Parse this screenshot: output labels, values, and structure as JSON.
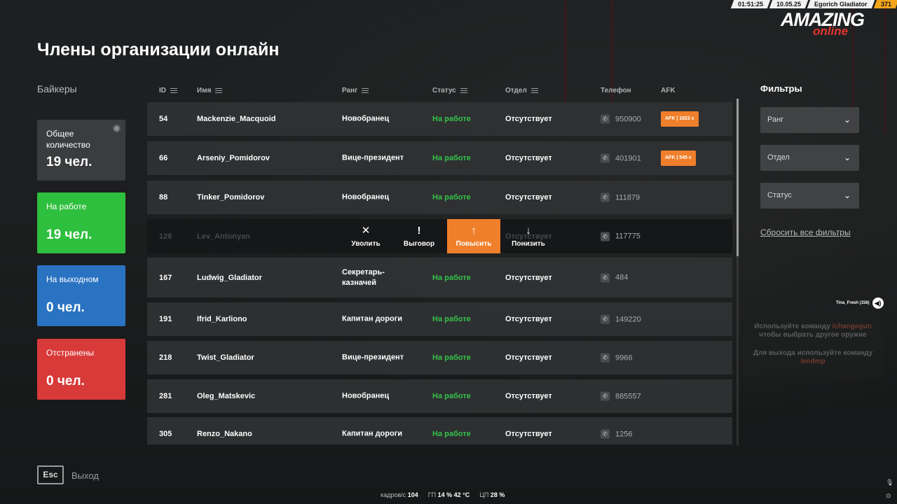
{
  "hud": {
    "time": "01:51:25",
    "date": "10.05.25",
    "player": "Egorich Gladiator",
    "level": "371"
  },
  "logo": {
    "top": "AMAZING",
    "bottom": "online"
  },
  "page_title": "Члены организации онлайн",
  "org_name": "Байкеры",
  "stats": {
    "total": {
      "label": "Общее количество",
      "value": "19 чел."
    },
    "working": {
      "label": "На работе",
      "value": "19 чел."
    },
    "off": {
      "label": "На выходном",
      "value": "0 чел."
    },
    "suspended": {
      "label": "Отстранены",
      "value": "0 чел."
    }
  },
  "table": {
    "headers": {
      "id": "ID",
      "name": "Имя",
      "rank": "Ранг",
      "status": "Статус",
      "dept": "Отдел",
      "phone": "Телефон",
      "afk": "AFK"
    },
    "rows": [
      {
        "id": "54",
        "name": "Mackenzie_Macquoid",
        "rank": "Новобранец",
        "status": "На работе",
        "dept": "Отсутствует",
        "phone": "950900",
        "afk": "AFK  |  1823 с"
      },
      {
        "id": "66",
        "name": "Arseniy_Pomidorov",
        "rank": "Вице-президент",
        "status": "На работе",
        "dept": "Отсутствует",
        "phone": "401901",
        "afk": "AFK  |  545 с"
      },
      {
        "id": "88",
        "name": "Tinker_Pomidorov",
        "rank": "Новобранец",
        "status": "На работе",
        "dept": "Отсутствует",
        "phone": "111879",
        "afk": ""
      },
      {
        "id": "126",
        "name": "Lev_Antonyan",
        "rank": "",
        "status": "",
        "dept": "Отсутствует",
        "phone": "117775",
        "afk": ""
      },
      {
        "id": "167",
        "name": "Ludwig_Gladiator",
        "rank": "Секретарь-казначей",
        "status": "На работе",
        "dept": "Отсутствует",
        "phone": "484",
        "afk": ""
      },
      {
        "id": "191",
        "name": "Ifrid_Karliono",
        "rank": "Капитан дороги",
        "status": "На работе",
        "dept": "Отсутствует",
        "phone": "149220",
        "afk": ""
      },
      {
        "id": "218",
        "name": "Twist_Gladiator",
        "rank": "Вице-президент",
        "status": "На работе",
        "dept": "Отсутствует",
        "phone": "9966",
        "afk": ""
      },
      {
        "id": "281",
        "name": "Oleg_Matskevic",
        "rank": "Новобранец",
        "status": "На работе",
        "dept": "Отсутствует",
        "phone": "885557",
        "afk": ""
      },
      {
        "id": "305",
        "name": "Renzo_Nakano",
        "rank": "Капитан дороги",
        "status": "На работе",
        "dept": "Отсутствует",
        "phone": "1256",
        "afk": ""
      }
    ]
  },
  "row_actions": {
    "fire": {
      "icon": "close-icon",
      "label": "Уволить"
    },
    "reprimand": {
      "icon": "exclamation-icon",
      "label": "Выговор"
    },
    "promote": {
      "icon": "arrow-up-icon",
      "label": "Повысить"
    },
    "demote": {
      "icon": "arrow-down-icon",
      "label": "Понизить"
    }
  },
  "filters": {
    "title": "Фильтры",
    "rank": "Ранг",
    "dept": "Отдел",
    "status": "Статус",
    "reset": "Сбросить все фильтры"
  },
  "voice": {
    "speaker": "Tina_Fresh (158)"
  },
  "hint": {
    "line1": "Используйте команду",
    "cmd1": "/changegun",
    "line2": "чтобы выбрать другое оружие",
    "line3": "Для выхода используйте команду",
    "cmd2": "/endmp"
  },
  "footer": {
    "esc": "Esc",
    "exit": "Выход"
  },
  "perf": {
    "fps_label": "кадров/с",
    "fps": "104",
    "gpu_label": "ГП",
    "gpu": "14 %",
    "gpu_temp": "42 °C",
    "cpu_label": "ЦП",
    "cpu": "28 %"
  },
  "colors": {
    "accent": "#f07f2b",
    "working": "#2fbf3e",
    "off": "#2a73c2",
    "suspended": "#d83a3a",
    "status_text": "#35c24a"
  }
}
